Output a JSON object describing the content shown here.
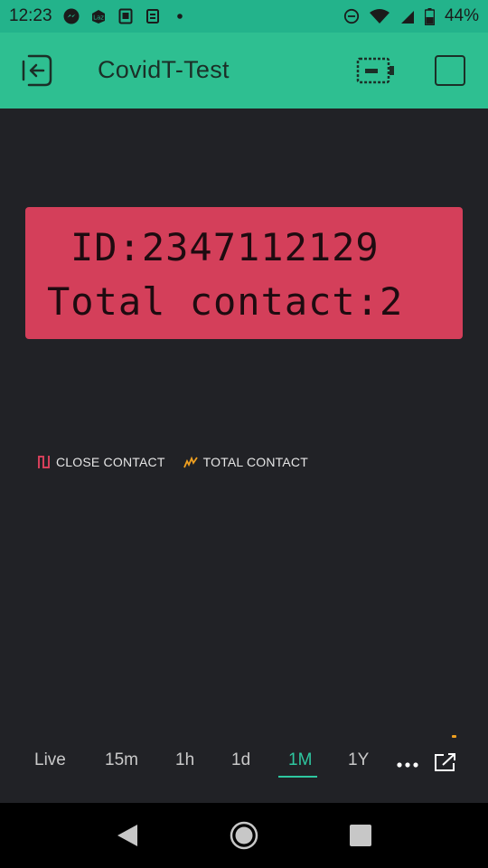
{
  "status_bar": {
    "time": "12:23",
    "battery_percent": "44%",
    "left_icons": [
      "messenger-icon",
      "lazada-icon",
      "document-app-icon",
      "clipboard-app-icon",
      "dot-icon"
    ],
    "right_icons": [
      "do-not-disturb-icon",
      "wifi-icon",
      "signal-icon",
      "battery-icon"
    ]
  },
  "app_bar": {
    "title": "CovidT-Test",
    "icons": [
      "exit-icon",
      "battery-widget-icon",
      "square-icon"
    ]
  },
  "lcd": {
    "line1": "ID:2347112129",
    "line2": "Total contact:2",
    "color": "#d43f5a"
  },
  "legend": {
    "items": [
      {
        "label": "CLOSE CONTACT",
        "color": "#d43f5a",
        "icon": "square-wave-icon"
      },
      {
        "label": "TOTAL CONTACT",
        "color": "#f0a020",
        "icon": "zigzag-line-icon"
      }
    ]
  },
  "period_tabs": {
    "items": [
      "Live",
      "15m",
      "1h",
      "1d",
      "1M",
      "1Y"
    ],
    "selected": "1M",
    "accent_color": "#2ec7a0"
  },
  "colors": {
    "header": "#2ebf91",
    "background": "#212226"
  }
}
